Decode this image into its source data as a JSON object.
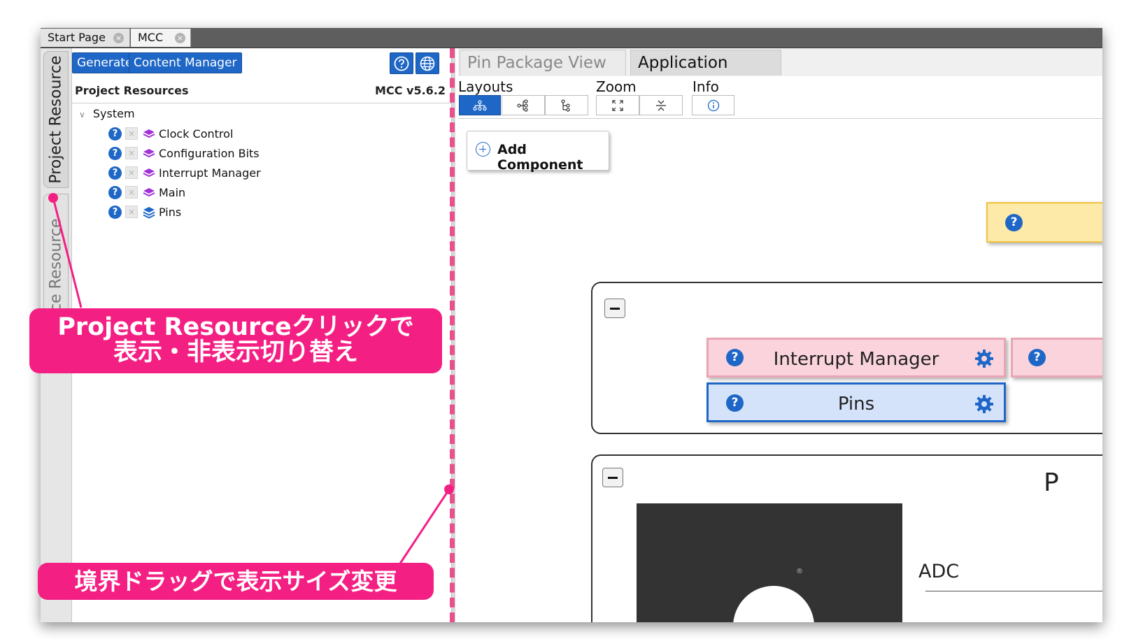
{
  "doc_tabs": [
    {
      "label": "Start Page",
      "close": "×"
    },
    {
      "label": "MCC",
      "close": "×"
    }
  ],
  "side_tabs": {
    "project": "Project Resource",
    "device": "Device Resource"
  },
  "toolbar": {
    "generate": "Generate",
    "content_manager": "Content Manager",
    "help_icon": "help-circle-icon",
    "globe_icon": "globe-icon"
  },
  "resources": {
    "title": "Project Resources",
    "version": "MCC v5.6.2",
    "root": "System",
    "items": [
      {
        "label": "Clock Control",
        "icon_color": "#a033d6"
      },
      {
        "label": "Configuration Bits",
        "icon_color": "#a033d6"
      },
      {
        "label": "Interrupt Manager",
        "icon_color": "#a033d6"
      },
      {
        "label": "Main",
        "icon_color": "#a033d6"
      },
      {
        "label": "Pins",
        "icon_color": "#1f67c7"
      }
    ]
  },
  "view_tabs": [
    {
      "label": "Pin Package View",
      "active": false
    },
    {
      "label": "Application Builder",
      "active": true
    }
  ],
  "builder_toolbar": {
    "layouts": "Layouts",
    "zoom": "Zoom",
    "info": "Info"
  },
  "canvas": {
    "add_component": "Add Component",
    "components": [
      {
        "label": "Interrupt Manager",
        "color": "#fbd3dd",
        "border": "#e9a5b6"
      },
      {
        "label": "Pins",
        "color": "#d4e3fa",
        "border": "#1f67c7"
      }
    ],
    "adc_label": "ADC",
    "partial_label": "P",
    "logo_mark": "®"
  },
  "annotations": {
    "toggle_line1": "Project Resourceクリックで",
    "toggle_line2": "表示・非表示切り替え",
    "resize": "境界ドラッグで表示サイズ変更"
  },
  "colors": {
    "accent": "#1f67c7",
    "annotation": "#f41f83",
    "splitter_dash": "#e8508e"
  }
}
